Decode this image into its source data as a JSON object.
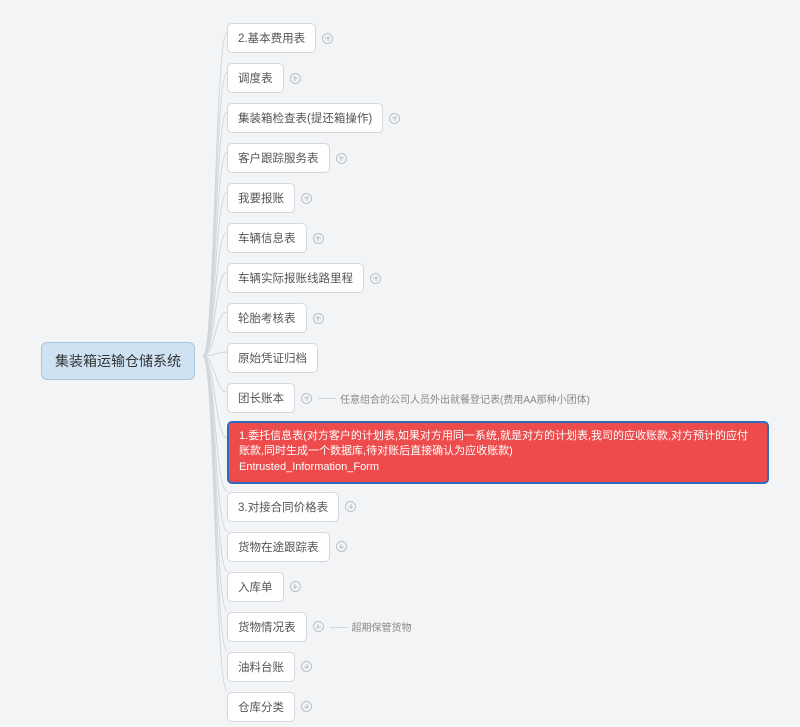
{
  "root": {
    "label": "集装箱运输仓储系统"
  },
  "children": [
    {
      "label": "2.基本费用表",
      "hasPlus": true
    },
    {
      "label": "调度表",
      "hasPlus": true
    },
    {
      "label": "集装箱检查表(提还箱操作)",
      "hasPlus": true
    },
    {
      "label": "客户跟踪服务表",
      "hasPlus": true
    },
    {
      "label": "我要报账",
      "hasPlus": true
    },
    {
      "label": "车辆信息表",
      "hasPlus": true
    },
    {
      "label": "车辆实际报账线路里程",
      "hasPlus": true
    },
    {
      "label": "轮胎考核表",
      "hasPlus": true
    },
    {
      "label": "原始凭证归档"
    },
    {
      "label": "团长账本",
      "hasPlus": true,
      "child": "任意组合的公司人员外出就餐登记表(费用AA那种小团体)"
    },
    {
      "highlighted": true,
      "label": "1.委托信息表(对方客户的计划表,如果对方用同一系统,就是对方的计划表,我司的应收账款,对方预计的应付账款,同时生成一个数据库,待对账后直接确认为应收账款)",
      "sub": "Entrusted_Information_Form"
    },
    {
      "label": "3.对接合同价格表",
      "hasPlus": true
    },
    {
      "label": "货物在途跟踪表",
      "hasPlus": true
    },
    {
      "label": "入库单",
      "hasPlus": true
    },
    {
      "label": "货物情况表",
      "hasPlus": true,
      "child": "超期保管货物"
    },
    {
      "label": "油料台账",
      "hasPlus": true
    },
    {
      "label": "仓库分类",
      "hasPlus": true
    }
  ],
  "connectors": {
    "rootRight": 203,
    "rootY": 356,
    "nodeLeft": 227,
    "rowCenters": [
      32,
      72,
      112,
      152,
      192,
      232,
      272,
      312,
      352,
      392,
      438,
      491,
      531,
      571,
      611,
      651,
      691
    ]
  }
}
